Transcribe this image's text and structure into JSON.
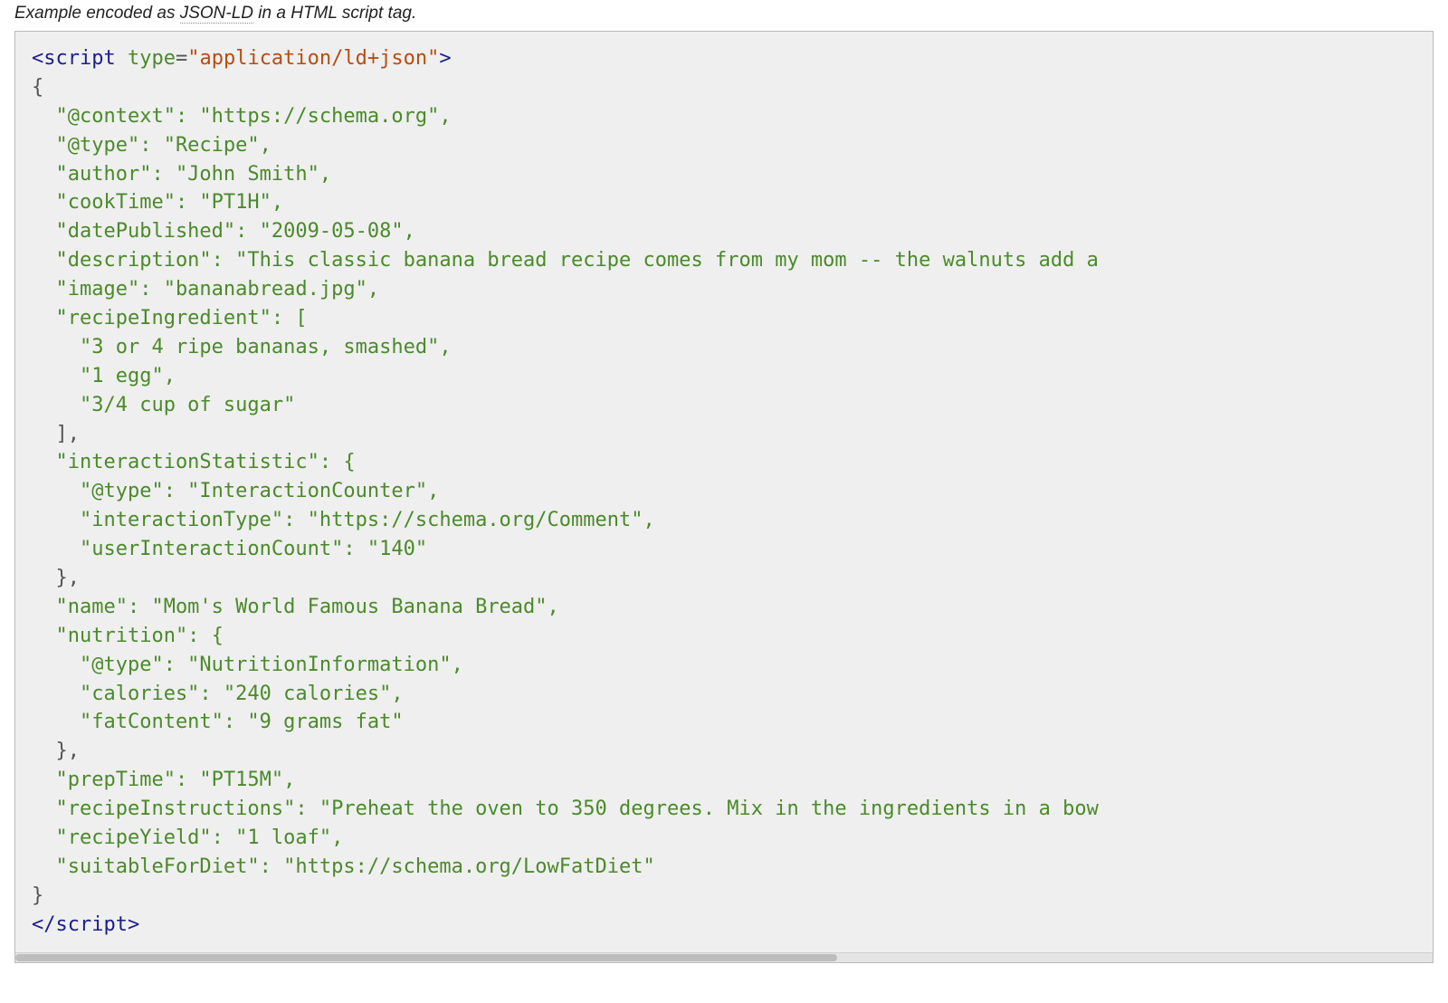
{
  "caption": {
    "prefix": "Example encoded as ",
    "abbr": "JSON-LD",
    "suffix": " in a HTML script tag."
  },
  "code": {
    "open_tag": {
      "lt": "<",
      "name": "script",
      "attr_name": "type",
      "eq": "=",
      "attr_value": "\"application/ld+json\"",
      "gt": ">"
    },
    "close_tag": {
      "lt": "</",
      "name": "script",
      "gt": ">"
    },
    "lines": {
      "l1": "{",
      "l2": "  \"@context\": \"https://schema.org\",",
      "l3": "  \"@type\": \"Recipe\",",
      "l4": "  \"author\": \"John Smith\",",
      "l5": "  \"cookTime\": \"PT1H\",",
      "l6": "  \"datePublished\": \"2009-05-08\",",
      "l7": "  \"description\": \"This classic banana bread recipe comes from my mom -- the walnuts add a ",
      "l8": "  \"image\": \"bananabread.jpg\",",
      "l9": "  \"recipeIngredient\": [",
      "l10": "    \"3 or 4 ripe bananas, smashed\",",
      "l11": "    \"1 egg\",",
      "l12": "    \"3/4 cup of sugar\"",
      "l13": "  ],",
      "l14": "  \"interactionStatistic\": {",
      "l15": "    \"@type\": \"InteractionCounter\",",
      "l16": "    \"interactionType\": \"https://schema.org/Comment\",",
      "l17": "    \"userInteractionCount\": \"140\"",
      "l18": "  },",
      "l19": "  \"name\": \"Mom's World Famous Banana Bread\",",
      "l20": "  \"nutrition\": {",
      "l21": "    \"@type\": \"NutritionInformation\",",
      "l22": "    \"calories\": \"240 calories\",",
      "l23": "    \"fatContent\": \"9 grams fat\"",
      "l24": "  },",
      "l25": "  \"prepTime\": \"PT15M\",",
      "l26": "  \"recipeInstructions\": \"Preheat the oven to 350 degrees. Mix in the ingredients in a bow",
      "l27": "  \"recipeYield\": \"1 loaf\",",
      "l28": "  \"suitableForDiet\": \"https://schema.org/LowFatDiet\"",
      "l29": "}"
    }
  }
}
